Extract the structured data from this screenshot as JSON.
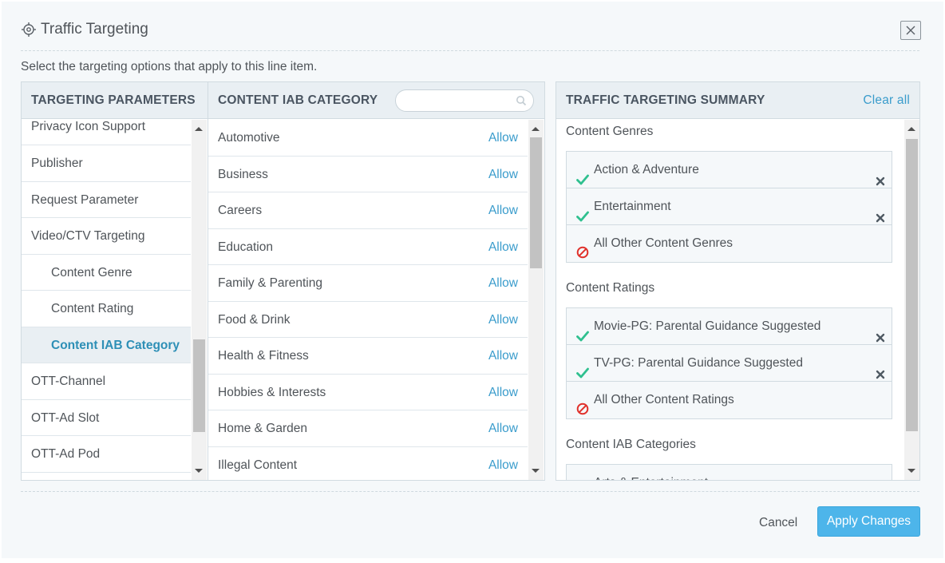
{
  "header": {
    "title": "Traffic Targeting",
    "title_icon": "crosshair-icon",
    "close_icon": "close-icon"
  },
  "subtitle": "Select the targeting options that apply to this line item.",
  "parameters": {
    "heading": "TARGETING PARAMETERS",
    "items": [
      {
        "label": "Privacy Icon Support"
      },
      {
        "label": "Publisher"
      },
      {
        "label": "Request Parameter"
      },
      {
        "label": "Video/CTV Targeting"
      },
      {
        "label": "Content Genre"
      },
      {
        "label": "Content Rating"
      },
      {
        "label": "Content IAB Category"
      },
      {
        "label": "OTT-Channel"
      },
      {
        "label": "OTT-Ad Slot"
      },
      {
        "label": "OTT-Ad Pod"
      }
    ]
  },
  "iab": {
    "heading": "CONTENT IAB CATEGORY",
    "search_placeholder": "",
    "allow_label": "Allow",
    "items": [
      {
        "label": "Automotive"
      },
      {
        "label": "Business"
      },
      {
        "label": "Careers"
      },
      {
        "label": "Education"
      },
      {
        "label": "Family & Parenting"
      },
      {
        "label": "Food & Drink"
      },
      {
        "label": "Health & Fitness"
      },
      {
        "label": "Hobbies & Interests"
      },
      {
        "label": "Home & Garden"
      },
      {
        "label": "Illegal Content"
      }
    ]
  },
  "summary": {
    "heading": "TRAFFIC TARGETING SUMMARY",
    "clear_all": "Clear all",
    "groups": [
      {
        "title": "Content Genres",
        "rows": [
          {
            "label": "Action & Adventure",
            "status": "allowed"
          },
          {
            "label": "Entertainment",
            "status": "allowed"
          },
          {
            "label": "All Other Content Genres",
            "status": "blocked"
          }
        ]
      },
      {
        "title": "Content Ratings",
        "rows": [
          {
            "label": "Movie-PG: Parental Guidance Suggested",
            "status": "allowed"
          },
          {
            "label": "TV-PG: Parental Guidance Suggested",
            "status": "allowed"
          },
          {
            "label": "All Other Content Ratings",
            "status": "blocked"
          }
        ]
      },
      {
        "title": "Content IAB Categories",
        "rows": [
          {
            "label": "Arts & Entertainment",
            "status": "allowed"
          }
        ]
      }
    ]
  },
  "footer": {
    "cancel": "Cancel",
    "apply": "Apply Changes"
  },
  "colors": {
    "accent": "#3a9ccc",
    "apply_bg": "#4db5ea",
    "check": "#2fc08f",
    "blocked": "#e0312b",
    "active_text": "#2d8fb6"
  }
}
